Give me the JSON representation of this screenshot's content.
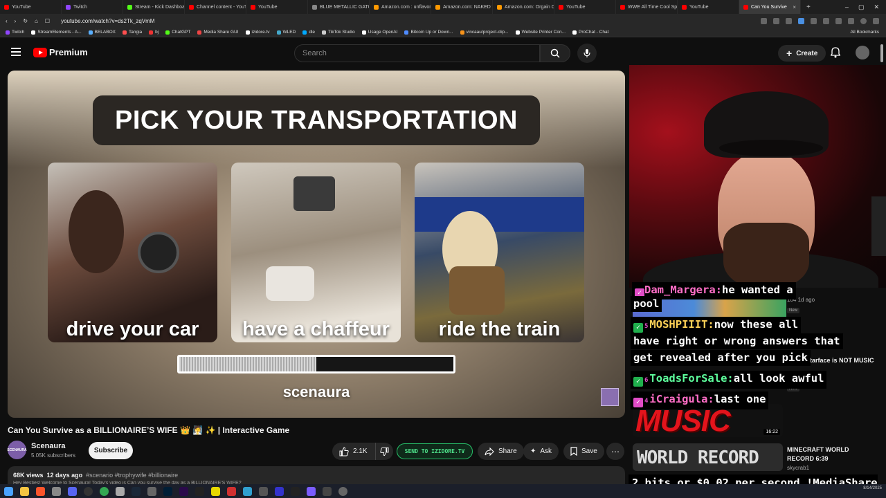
{
  "browser": {
    "tabs": [
      {
        "label": "YouTube",
        "color": "#ff0000"
      },
      {
        "label": "Twitch",
        "color": "#9146ff"
      },
      {
        "label": "Stream - Kick Dashboa",
        "color": "#53fc18"
      },
      {
        "label": "Channel content - YouT",
        "color": "#ff0000"
      },
      {
        "label": "YouTube",
        "color": "#ff0000"
      },
      {
        "label": "BLUE METALLIC GATOR",
        "color": "#888888"
      },
      {
        "label": "Amazon.com : unflavore",
        "color": "#ff9900"
      },
      {
        "label": "Amazon.com: NAKED W",
        "color": "#ff9900"
      },
      {
        "label": "Amazon.com: Orgain O",
        "color": "#ff9900"
      },
      {
        "label": "YouTube",
        "color": "#ff0000"
      },
      {
        "label": "WWE All Time Cool Spe",
        "color": "#ff0000"
      },
      {
        "label": "YouTube",
        "color": "#ff0000"
      },
      {
        "label": "Can You Survive",
        "color": "#ff0000",
        "active": true
      }
    ],
    "url": "youtube.com/watch?v=ds2Tk_zqVmM",
    "bookmarks": [
      "Twitch",
      "StreamElements - A...",
      "BELABOX",
      "Tangia",
      "bj",
      "ChatGPT",
      "Media Share GUI",
      "izidore.tv",
      "WLED",
      "dle",
      "TikTok Studio",
      "Usage OpenAI",
      "Bitcoin Up or Down...",
      "vincaau/project-clip...",
      "Website Printer Con...",
      "ProChat - Chat"
    ],
    "all_bookmarks": "All Bookmarks"
  },
  "youtube": {
    "logo_text": "Premium",
    "search_placeholder": "Search",
    "create_label": "Create"
  },
  "video": {
    "headline": "PICK YOUR TRANSPORTATION",
    "options": [
      "drive your car",
      "have a chaffeur",
      "ride the train"
    ],
    "progress_fraction": 0.5,
    "watermark": "scenaura",
    "title": "Can You Survive as a BILLIONAIRE’S WIFE 👑 🧖 ✨ | Interactive Game",
    "channel": "Scenaura",
    "channel_avatar_text": "SCENAURA",
    "subscribers": "5.05K subscribers",
    "subscribe_label": "Subscribe",
    "likes": "2.1K",
    "izidore_label": "SEND TO IZIDORE.TV",
    "share_label": "Share",
    "ask_label": "Ask",
    "save_label": "Save",
    "views": "68K views",
    "age": "12 days ago",
    "tags": "#scenario #trophywife #billionaire",
    "description_line": "Hey Besties! Welcome to Scenaura! Today's video is Can you survive the day as a BILLIONAIRE'S WIFE?"
  },
  "recommendations": [
    {
      "meta": "104  1d ago",
      "badge": "New"
    },
    {
      "title": "$tarface is NOT MUSIC",
      "badge": "New",
      "duration": "16:22"
    },
    {
      "title": "MINECRAFT WORLD RECORD 6:39",
      "channel": "skycrab1"
    }
  ],
  "stream_overlay": {
    "chat": [
      {
        "user": "Dam_Margera:",
        "msg": "he wanted a",
        "sub_months": "",
        "style": "pink"
      },
      {
        "user": "",
        "msg": "pool",
        "sub_months": "",
        "style": ""
      },
      {
        "user": "MOSHPIIIT:",
        "msg": "now these all",
        "sub_months": "5",
        "style": "gold"
      },
      {
        "user": "",
        "msg": "have right or wrong answers that",
        "sub_months": "",
        "style": ""
      },
      {
        "user": "",
        "msg": "get revealed after you pick",
        "sub_months": "",
        "style": ""
      },
      {
        "user": "ToadsForSale:",
        "msg": "all look awful",
        "sub_months": "6",
        "style": "green"
      },
      {
        "user": "iCraigula:",
        "msg": "last one",
        "sub_months": "4",
        "style": "pink"
      }
    ],
    "music_text": "MUSIC",
    "world_record_text": "WORLD RECORD",
    "bits_text": "2 bits or $0.02 per second !MediaShare"
  },
  "taskbar": {
    "date": "8/14/2025"
  },
  "colors": {
    "accent": "#ff0000",
    "izidore_green": "#4ee38b"
  }
}
